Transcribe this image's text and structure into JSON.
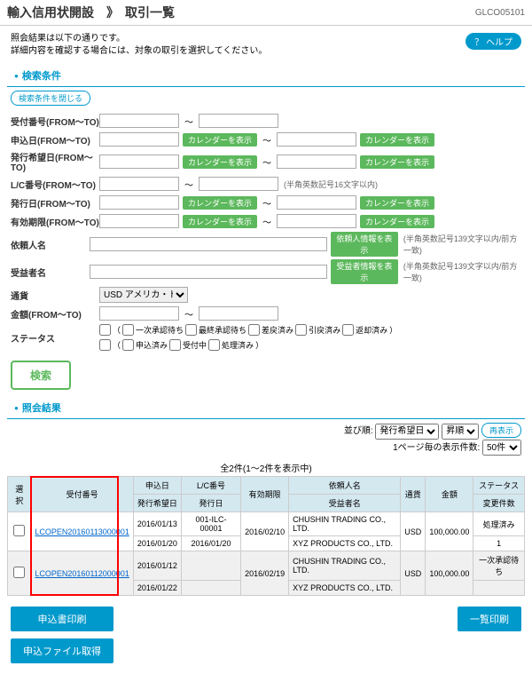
{
  "header": {
    "title": "輸入信用状開設　》　取引一覧",
    "code": "GLCO05101"
  },
  "subheader": {
    "line1": "照会結果は以下の通りです。",
    "line2": "詳細内容を確認する場合には、対象の取引を選択してください。",
    "help": "？ ヘルプ"
  },
  "sections": {
    "search": "検索条件",
    "result": "照会結果"
  },
  "close_search": "検索条件を閉じる",
  "form": {
    "labels": {
      "ref_no": "受付番号(FROM～TO)",
      "apply_date": "申込日(FROM～TO)",
      "issue_wish": "発行希望日(FROM～TO)",
      "lc_no": "L/C番号(FROM～TO)",
      "issue_date": "発行日(FROM～TO)",
      "expiry": "有効期限(FROM～TO)",
      "applicant": "依頼人名",
      "beneficiary": "受益者名",
      "currency": "通貨",
      "amount": "金額(FROM～TO)",
      "status": "ステータス"
    },
    "sep": "～",
    "cal_btn": "カレンダーを表示",
    "applicant_btn": "依頼人情報を表示",
    "beneficiary_btn": "受益者情報を表示",
    "hint_lc": "(半角英数記号16文字以内)",
    "hint_name": "(半角英数記号139文字以内/前方一致)",
    "currency_value": "USD アメリカ・ドル",
    "status_items": [
      "一次承認待ち",
      "最終承認待ち",
      "差戻済み",
      "引戻済み",
      "返却済み",
      "申込済み",
      "受付中",
      "処理済み"
    ],
    "search_btn": "検索"
  },
  "result_controls": {
    "sort_label": "並び順:",
    "sort_value": "発行希望日",
    "order_value": "昇順",
    "redraw": "再表示",
    "per_page_label": "1ページ毎の表示件数:",
    "per_page_value": "50件"
  },
  "count": "全2件(1～2件を表示中)",
  "table": {
    "headers": {
      "select": "選択",
      "ref_no": "受付番号",
      "apply_date": "申込日",
      "issue_wish": "発行希望日",
      "lc_no": "L/C番号",
      "issue_date": "発行日",
      "expiry": "有効期限",
      "applicant": "依頼人名",
      "beneficiary": "受益者名",
      "currency": "通貨",
      "amount": "金額",
      "status": "ステータス",
      "change_count": "変更件数"
    },
    "rows": [
      {
        "ref_no": "LCOPEN20160113000001",
        "apply_date": "2016/01/13",
        "issue_wish": "2016/01/20",
        "lc_no": "001-ILC-00001",
        "issue_date": "2016/01/20",
        "expiry": "2016/02/10",
        "applicant": "CHUSHIN TRADING CO., LTD.",
        "beneficiary": "XYZ PRODUCTS CO., LTD.",
        "currency": "USD",
        "amount": "100,000.00",
        "status": "処理済み",
        "change_count": "1"
      },
      {
        "ref_no": "LCOPEN20160112000001",
        "apply_date": "2016/01/12",
        "issue_wish": "2016/01/22",
        "lc_no": "",
        "issue_date": "",
        "expiry": "2016/02/19",
        "applicant": "CHUSHIN TRADING CO., LTD.",
        "beneficiary": "XYZ PRODUCTS CO., LTD.",
        "currency": "USD",
        "amount": "100,000.00",
        "status": "一次承認待ち",
        "change_count": ""
      }
    ]
  },
  "bottom": {
    "print_app": "申込書印刷",
    "get_file": "申込ファイル取得",
    "print_list": "一覧印刷"
  }
}
